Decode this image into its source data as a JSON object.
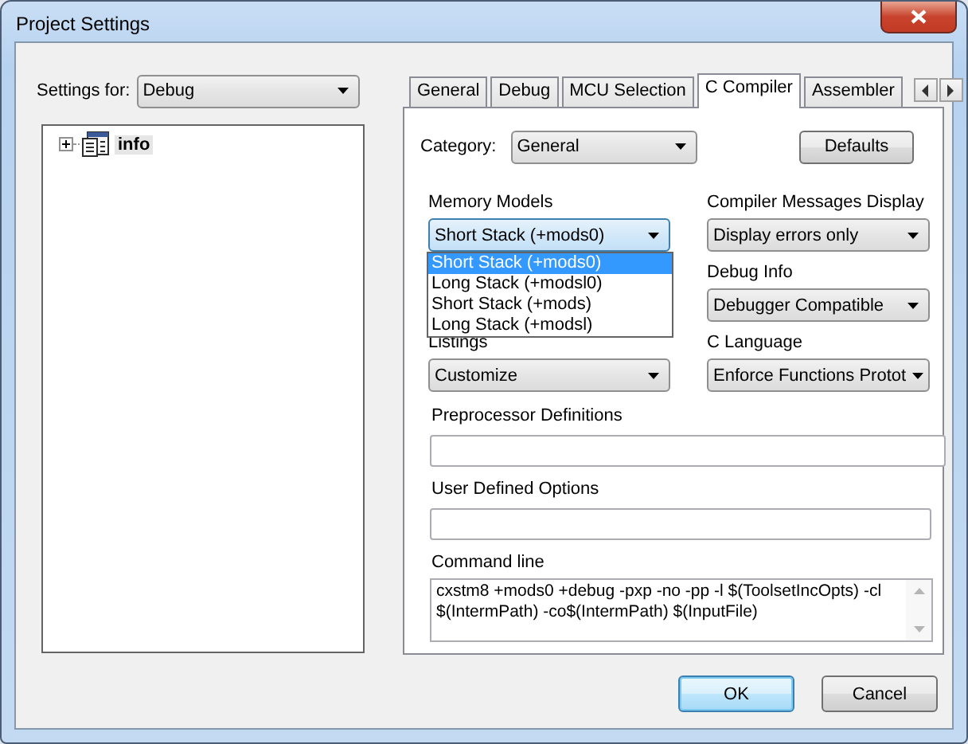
{
  "window": {
    "title": "Project Settings"
  },
  "settings_for": {
    "label": "Settings for:",
    "value": "Debug"
  },
  "tree": [
    {
      "label": "info",
      "expanded": false,
      "selected": true
    }
  ],
  "tabs": [
    {
      "label": "General",
      "selected": false
    },
    {
      "label": "Debug",
      "selected": false
    },
    {
      "label": "MCU Selection",
      "selected": false
    },
    {
      "label": "C Compiler",
      "selected": true
    },
    {
      "label": "Assembler",
      "selected": false
    }
  ],
  "category": {
    "label": "Category:",
    "value": "General"
  },
  "defaults_button": "Defaults",
  "left_options": [
    {
      "label": "Memory Models",
      "value": "Short Stack (+mods0)",
      "focused": true,
      "open": true,
      "options": [
        {
          "label": "Short Stack (+mods0)",
          "selected": true
        },
        {
          "label": "Long Stack (+modsl0)",
          "selected": false
        },
        {
          "label": "Short Stack (+mods)",
          "selected": false
        },
        {
          "label": "Long Stack (+modsl)",
          "selected": false
        }
      ]
    },
    {
      "label": "Listings",
      "value": "Customize",
      "focused": false,
      "open": false
    }
  ],
  "right_options": [
    {
      "label": "Compiler Messages Display",
      "value": "Display errors only",
      "focused": false,
      "open": false
    },
    {
      "label": "Debug Info",
      "value": "Debugger Compatible",
      "focused": false,
      "open": false
    },
    {
      "label": "C Language",
      "value": "Enforce Functions Protot",
      "focused": false,
      "open": false
    }
  ],
  "text_fields": [
    {
      "kind": "line",
      "label": "Preprocessor Definitions",
      "wide": true
    },
    {
      "kind": "line",
      "label": "User Defined Options",
      "wide": false
    },
    {
      "kind": "multiline",
      "label": "Command line",
      "value": "cxstm8 +mods0 +debug -pxp -no -pp -l $(ToolsetIncOpts) -cl $(IntermPath) -co$(IntermPath) $(InputFile)",
      "wide": false
    }
  ],
  "buttons": [
    {
      "label": "OK",
      "default": true
    },
    {
      "label": "Cancel",
      "default": false
    }
  ]
}
